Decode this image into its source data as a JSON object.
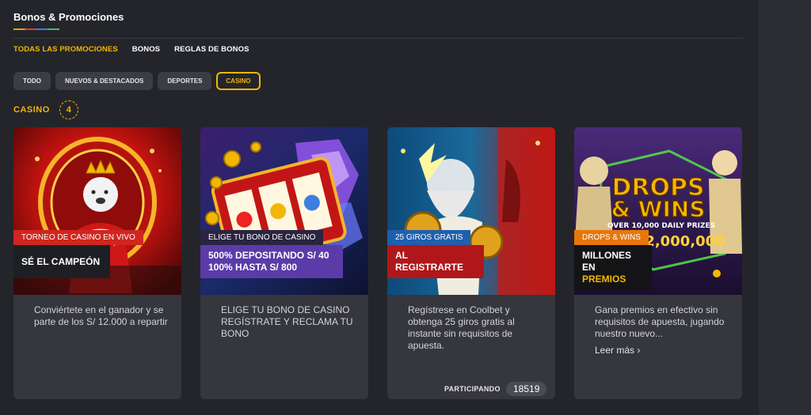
{
  "page": {
    "title": "Bonos & Promociones"
  },
  "tabs": [
    {
      "label": "TODAS LAS PROMOCIONES",
      "active": true
    },
    {
      "label": "BONOS",
      "active": false
    },
    {
      "label": "REGLAS DE BONOS",
      "active": false
    }
  ],
  "filters": [
    {
      "label": "TODO",
      "active": false
    },
    {
      "label": "NUEVOS & DESTACADOS",
      "active": false
    },
    {
      "label": "DEPORTES",
      "active": false
    },
    {
      "label": "CASINO",
      "active": true
    }
  ],
  "section": {
    "label": "CASINO",
    "count": "4"
  },
  "cards": [
    {
      "tag": "TORNEO DE CASINO EN VIVO",
      "headline_1": "SÉ EL CAMPEÓN",
      "headline_2": "",
      "description": "Conviértete en el ganador y se parte de los S/ 12.000 a repartir",
      "tag_color": "#d0261f",
      "headline_color": "#1e1f24"
    },
    {
      "tag": "ELIGE TU BONO DE CASINO",
      "headline_1": "500% DEPOSITANDO S/ 40",
      "headline_2": "100% HASTA S/ 800",
      "description": "ELIGE TU BONO DE CASINO REGÍSTRATE Y RECLAMA TU BONO",
      "tag_color": "#2b2440",
      "headline_color": "#5b3ba8"
    },
    {
      "tag": "25 GIROS GRATIS",
      "headline_1": "AL REGISTRARTE",
      "headline_2": "",
      "description": "Regístrese en Coolbet y obtenga 25 giros gratis al instante sin requisitos de apuesta.",
      "tag_color": "#1f5fb0",
      "headline_color": "#b0171a",
      "participating_label": "PARTICIPANDO",
      "participating_count": "18519"
    },
    {
      "tag": "DROPS & WINS",
      "headline_1": "MILLONES EN",
      "headline_2": "PREMIOS",
      "description": "Gana premios en efectivo sin requisitos de apuesta, jugando nuestro nuevo...",
      "more": "Leer más ›",
      "tag_color": "#e8760b",
      "headline_color": "#141416",
      "art_title_1": "DROPS",
      "art_title_2": "& WINS",
      "art_subtitle": "OVER 10,000 DAILY PRIZES",
      "art_amount": "2,000,000"
    }
  ]
}
